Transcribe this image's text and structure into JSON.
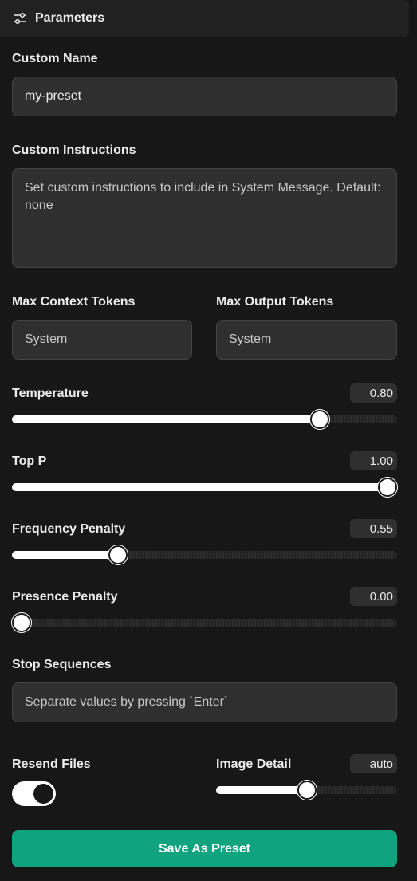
{
  "header": {
    "title": "Parameters",
    "icon": "sliders-icon"
  },
  "custom_name": {
    "label": "Custom Name",
    "value": "my-preset"
  },
  "custom_instructions": {
    "label": "Custom Instructions",
    "placeholder": "Set custom instructions to include in System Message. Default: none"
  },
  "max_context_tokens": {
    "label": "Max Context Tokens",
    "placeholder": "System"
  },
  "max_output_tokens": {
    "label": "Max Output Tokens",
    "placeholder": "System"
  },
  "temperature": {
    "label": "Temperature",
    "display": "0.80",
    "fraction": 0.8
  },
  "top_p": {
    "label": "Top P",
    "display": "1.00",
    "fraction": 1.0
  },
  "frequency_penalty": {
    "label": "Frequency Penalty",
    "display": "0.55",
    "fraction": 0.275
  },
  "presence_penalty": {
    "label": "Presence Penalty",
    "display": "0.00",
    "fraction": 0.0
  },
  "stop_sequences": {
    "label": "Stop Sequences",
    "placeholder": "Separate values by pressing `Enter`"
  },
  "resend_files": {
    "label": "Resend Files",
    "enabled": true
  },
  "image_detail": {
    "label": "Image Detail",
    "display": "auto",
    "fraction": 0.5
  },
  "save_button": {
    "label": "Save As Preset"
  },
  "colors": {
    "background": "#171717",
    "field": "#2f2f2f",
    "accent": "#10a37f",
    "slider_fill": "#ffffff"
  }
}
